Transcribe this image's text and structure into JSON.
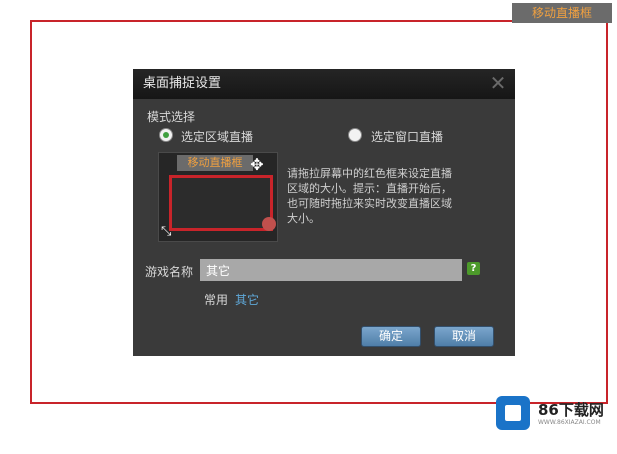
{
  "top_tab": {
    "label": "移动直播框"
  },
  "dialog": {
    "title": "桌面捕捉设置",
    "close_glyph": "✕",
    "mode_label": "模式选择",
    "modes": [
      {
        "label": "选定区域直播",
        "selected": true
      },
      {
        "label": "选定窗口直播",
        "selected": false
      }
    ],
    "preview": {
      "tab_label": "移动直播框",
      "move_icon": "move-cursor-icon",
      "resize_icon": "resize-icon"
    },
    "hint": "请拖拉屏幕中的红色框来设定直播区域的大小。提示：直播开始后，也可随时拖拉来实时改变直播区域大小。",
    "game_name_label": "游戏名称",
    "game_name_value": "其它",
    "help_glyph": "?",
    "common_label": "常用",
    "common_link": "其它",
    "ok_label": "确定",
    "cancel_label": "取消"
  },
  "watermark": {
    "brand": "86下载网",
    "url": "WWW.86XIAZAI.COM"
  },
  "colors": {
    "frame": "#c8242a",
    "dialog_bg": "#3a3a3a",
    "accent": "#f0a040",
    "button": "#5a88b4"
  }
}
